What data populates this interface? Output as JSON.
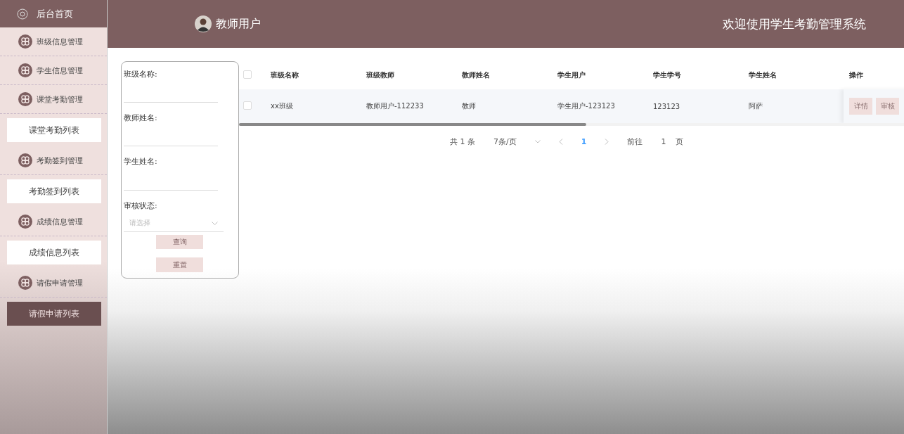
{
  "sidebar": [
    {
      "kind": "home",
      "label": "后台首页"
    },
    {
      "kind": "group",
      "label": "班级信息管理"
    },
    {
      "kind": "group",
      "label": "学生信息管理"
    },
    {
      "kind": "group",
      "label": "课堂考勤管理"
    },
    {
      "kind": "sub",
      "label": "课堂考勤列表",
      "selected": false
    },
    {
      "kind": "group",
      "label": "考勤签到管理"
    },
    {
      "kind": "sub",
      "label": "考勤签到列表",
      "selected": false
    },
    {
      "kind": "group",
      "label": "成绩信息管理"
    },
    {
      "kind": "sub",
      "label": "成绩信息列表",
      "selected": false
    },
    {
      "kind": "group",
      "label": "请假申请管理"
    },
    {
      "kind": "sub",
      "label": "请假申请列表",
      "selected": true
    }
  ],
  "header": {
    "user": "教师用户",
    "title": "欢迎使用学生考勤管理系统"
  },
  "filters": [
    {
      "kind": "text",
      "label": "班级名称:"
    },
    {
      "kind": "text",
      "label": "教师姓名:"
    },
    {
      "kind": "text",
      "label": "学生姓名:"
    },
    {
      "kind": "select",
      "label": "审核状态:",
      "placeholder": "请选择"
    }
  ],
  "filter_buttons": [
    "查询",
    "重置"
  ],
  "table": {
    "all_checked": false,
    "columns": [
      "班级名称",
      "班级教师",
      "教师姓名",
      "学生用户",
      "学生学号",
      "学生姓名"
    ],
    "action_column": "操作",
    "rows": [
      {
        "checked": false,
        "cells": [
          "xx班级",
          "教师用户-112233",
          "教师",
          "学生用户-123123",
          "123123",
          "阿萨"
        ],
        "actions": [
          "详情",
          "审核"
        ]
      }
    ]
  },
  "pagination": {
    "total": "共 1 条",
    "page_size": "7条/页",
    "pages": [
      {
        "label": "1",
        "selected": true
      }
    ],
    "goto_label": "前往",
    "goto_value": "1",
    "page_unit": "页"
  }
}
